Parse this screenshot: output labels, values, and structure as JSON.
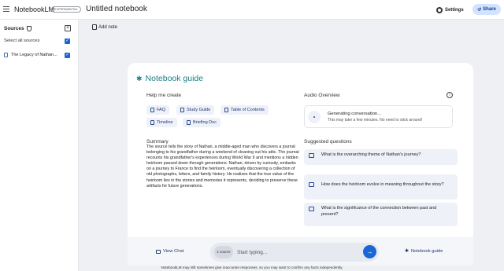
{
  "header": {
    "app_title": "NotebookLM",
    "badge": "EXPERIMENTAL",
    "notebook_title": "Untitled notebook",
    "settings_label": "Settings",
    "share_label": "Share"
  },
  "sidebar": {
    "sources_label": "Sources",
    "select_all_label": "Select all sources",
    "select_all_checked": true,
    "items": [
      {
        "label": "The Legacy of Nathan...",
        "checked": true,
        "icon": "document-icon"
      }
    ]
  },
  "notes": {
    "add_note_label": "Add note"
  },
  "guide": {
    "title": "Notebook guide",
    "help_heading": "Help me create",
    "chips": [
      {
        "label": "FAQ",
        "icon": "faq-icon"
      },
      {
        "label": "Study Guide",
        "icon": "study-guide-icon"
      },
      {
        "label": "Table of Contents",
        "icon": "table-of-contents-icon"
      },
      {
        "label": "Timeline",
        "icon": "timeline-icon"
      },
      {
        "label": "Briefing Doc",
        "icon": "briefing-doc-icon"
      }
    ],
    "summary_heading": "Summary",
    "summary_text": "The source tells the story of Nathan, a middle-aged man who discovers a journal belonging to his grandfather during a weekend of cleaning out his attic. The journal recounts his grandfather's experiences during World War II and mentions a hidden heirloom passed down through generations. Nathan, driven by curiosity, embarks on a journey to France to find the heirloom, eventually discovering a collection of old photographs, letters, and family history. He realizes that the true value of the heirloom lies in the stories and memories it represents, deciding to preserve these artifacts for future generations.",
    "audio_heading": "Audio Overview",
    "audio_status": "Generating conversation...",
    "audio_substatus": "This may take a few minutes. No need to stick around!",
    "suggested_heading": "Suggested questions",
    "questions": [
      "What is the overarching theme of Nathan's journey?",
      "How does the heirloom evolve in meaning throughout the story?",
      "What is the significance of the connection between past and present?"
    ]
  },
  "chat": {
    "view_chat_label": "View Chat",
    "source_count": "1 source",
    "placeholder": "Start typing...",
    "notebook_guide_label": "Notebook guide"
  },
  "footer": {
    "disclaimer": "NotebookLM may still sometimes give inaccurate responses, so you may want to confirm any facts independently."
  },
  "colors": {
    "accent": "#1a66d6",
    "guide_title": "#1a7f86",
    "share_bg": "#d3e3fd",
    "chip_bg": "#eef1f8"
  }
}
